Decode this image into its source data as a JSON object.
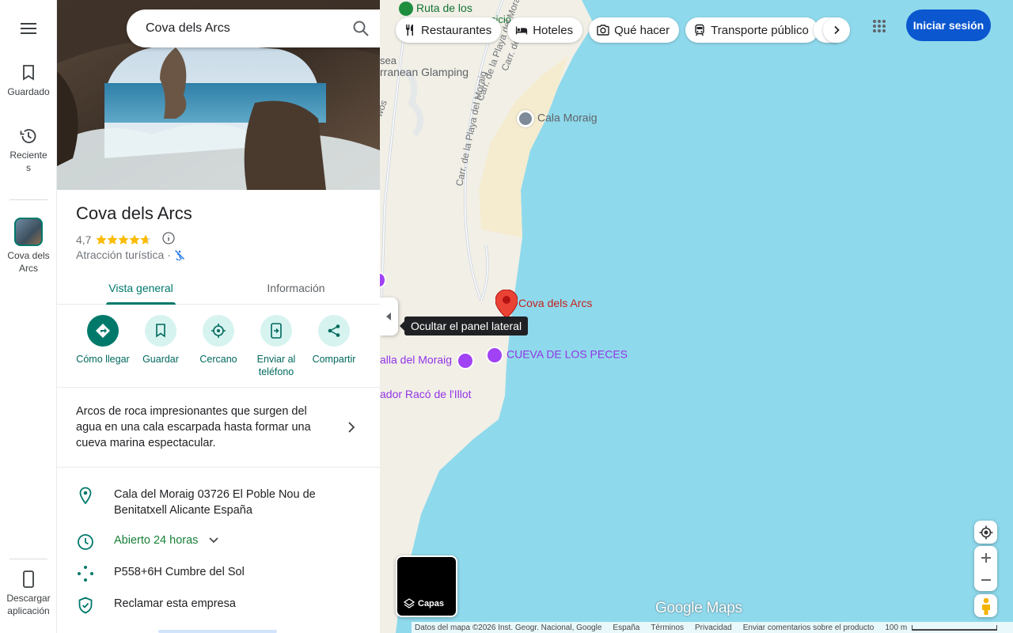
{
  "search": {
    "value": "Cova dels Arcs"
  },
  "rail": {
    "menu_icon": "menu-icon",
    "items": [
      {
        "label": "Guardado",
        "icon": "bookmark-icon"
      },
      {
        "label": "Reciente\ns",
        "icon": "history-icon"
      },
      {
        "label": "Cova dels\nArcs",
        "icon": "place-thumbnail"
      }
    ],
    "download_label": "Descargar\naplicación"
  },
  "place": {
    "title": "Cova dels Arcs",
    "rating": "4,7",
    "stars": 4.7,
    "category": "Atracción turística",
    "category_suffix": "·",
    "tabs": {
      "overview": "Vista general",
      "info": "Información"
    },
    "actions": [
      {
        "label": "Cómo llegar",
        "icon": "directions-icon"
      },
      {
        "label": "Guardar",
        "icon": "bookmark-icon"
      },
      {
        "label": "Cercano",
        "icon": "nearby-icon"
      },
      {
        "label": "Enviar al teléfono",
        "icon": "send-to-phone-icon"
      },
      {
        "label": "Compartir",
        "icon": "share-icon"
      }
    ],
    "description": "Arcos de roca impresionantes que surgen del agua en una cala escarpada hasta formar una cueva marina espectacular.",
    "address": "Cala del Moraig 03726 El Poble Nou de Benitatxell Alicante España",
    "hours": "Abierto 24 horas",
    "plus_code": "P558+6H Cumbre del Sol",
    "claim": "Reclamar esta empresa"
  },
  "map": {
    "chips": [
      {
        "label": "Restaurantes",
        "icon": "restaurant-icon"
      },
      {
        "label": "Hoteles",
        "icon": "hotel-icon"
      },
      {
        "label": "Qué hacer",
        "icon": "camera-icon"
      },
      {
        "label": "Transporte público",
        "icon": "transit-icon"
      }
    ],
    "signin": "Iniciar sesión",
    "tooltip": "Ocultar el panel lateral",
    "layers": "Capas",
    "logo": "Google Maps",
    "labels": {
      "ruta": "Ruta de los",
      "ruta_suffix": "cicio",
      "sea": "sea",
      "glamping": "rranean Glamping",
      "cala_moraig": "Cala Moraig",
      "cova": "Cova dels Arcs",
      "cueva": "CUEVA DE LOS PECES",
      "playa": "alla del Moraig",
      "mirador": "ador Racó de l'Illot",
      "road1": "Carr. de la Playa del Moraig",
      "road2": "Carr. de",
      "road3": "Carr. de la Playa del Moraig",
      "road4": "wos"
    },
    "footer": {
      "data": "Datos del mapa ©2026 Inst. Geogr. Nacional, Google",
      "country": "España",
      "terms": "Términos",
      "privacy": "Privacidad",
      "feedback": "Enviar comentarios sobre el producto",
      "scale": "100 m"
    }
  },
  "colors": {
    "water": "#8fd9ec",
    "land": "#f1efe6",
    "sand": "#f5ecd0",
    "accent": "#00796b",
    "signin": "#0b57d0",
    "pin": "#ea4335"
  }
}
